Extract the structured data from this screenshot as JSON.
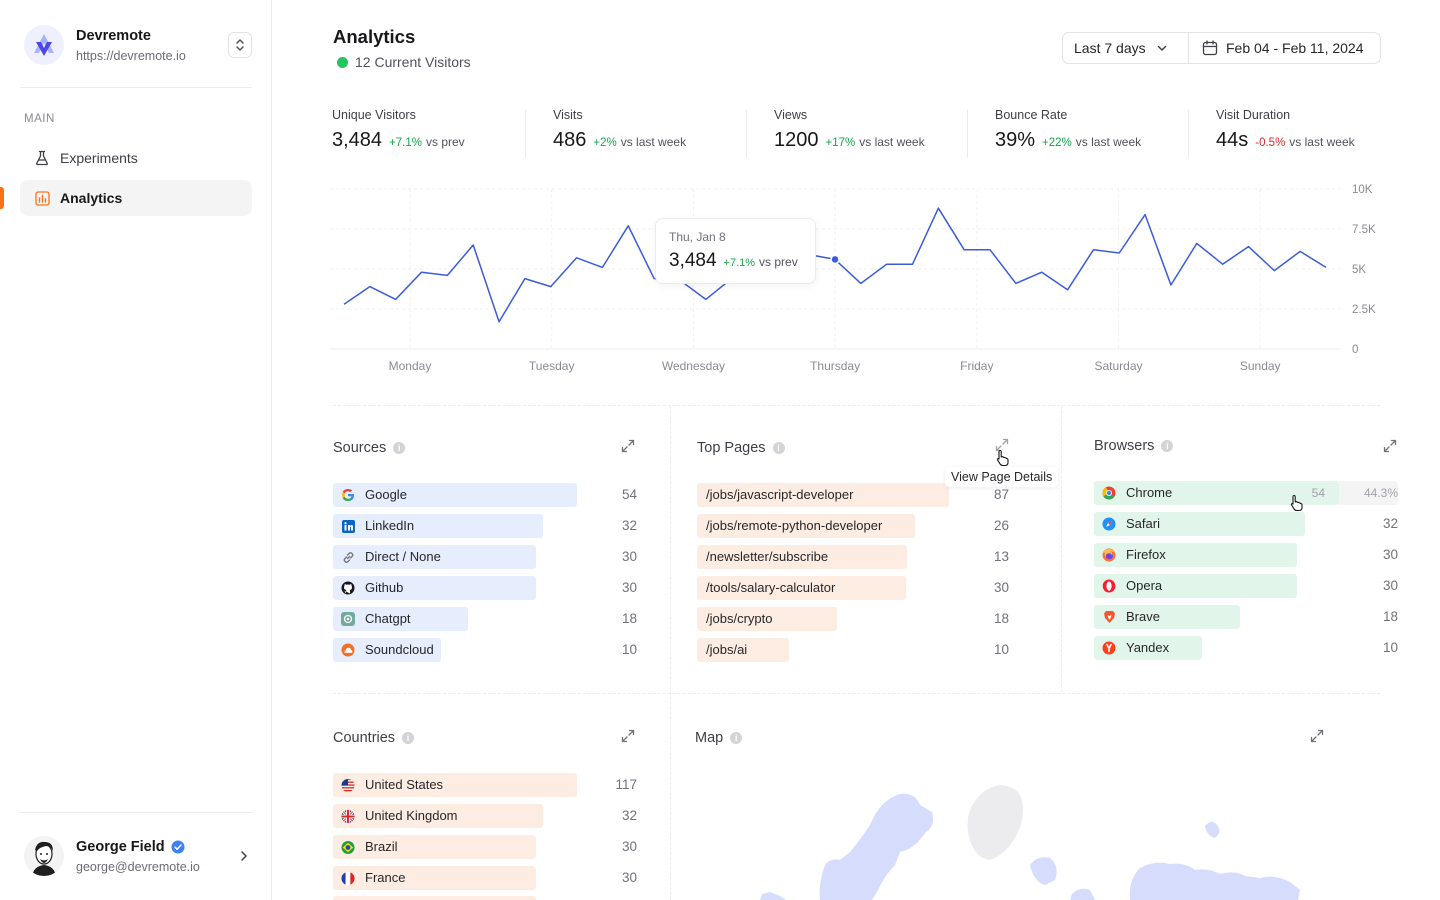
{
  "sidebar": {
    "org": {
      "name": "Devremote",
      "url": "https://devremote.io"
    },
    "section": "MAIN",
    "items": [
      {
        "label": "Experiments",
        "icon": "flask-icon"
      },
      {
        "label": "Analytics",
        "icon": "bar-chart-icon",
        "active": true
      }
    ],
    "user": {
      "name": "George Field",
      "email": "george@devremote.io",
      "verified": true
    }
  },
  "header": {
    "title": "Analytics",
    "current_visitors": "12 Current Visitors",
    "range_select": "Last 7 days",
    "date_range": "Feb 04 - Feb 11, 2024"
  },
  "stats": [
    {
      "label": "Unique Visitors",
      "value": "3,484",
      "delta": "+7.1%",
      "compare": "vs prev",
      "trend": "up"
    },
    {
      "label": "Visits",
      "value": "486",
      "delta": "+2%",
      "compare": "vs last week",
      "trend": "up"
    },
    {
      "label": "Views",
      "value": "1200",
      "delta": "+17%",
      "compare": "vs last week",
      "trend": "up"
    },
    {
      "label": "Bounce Rate",
      "value": "39%",
      "delta": "+22%",
      "compare": "vs last week",
      "trend": "up"
    },
    {
      "label": "Visit Duration",
      "value": "44s",
      "delta": "-0.5%",
      "compare": "vs last week",
      "trend": "down"
    }
  ],
  "chart_data": {
    "type": "line",
    "categories": [
      "Monday",
      "Tuesday",
      "Wednesday",
      "Thursday",
      "Friday",
      "Saturday",
      "Sunday"
    ],
    "yticks": [
      "10K",
      "7.5K",
      "5K",
      "2.5K",
      "0"
    ],
    "ylim": [
      0,
      10000
    ],
    "series": [
      {
        "values": [
          2800,
          3900,
          3100,
          4800,
          4600,
          6500,
          1700,
          4400,
          3900,
          5700,
          5100,
          7700,
          4400,
          4300,
          3100,
          4400,
          5400,
          6100,
          5900,
          5600,
          4100,
          5300,
          5300,
          8800,
          6200,
          6200,
          4100,
          4800,
          3700,
          6200,
          6000,
          8400,
          4000,
          6600,
          5300,
          6400,
          4900,
          6100,
          5100
        ],
        "color": "#3b5bdb"
      }
    ],
    "highlight_index": 19,
    "tooltip": {
      "date": "Thu, Jan 8",
      "value": "3,484",
      "delta": "+7.1%",
      "compare": "vs prev"
    }
  },
  "sources": {
    "title": "Sources",
    "rows": [
      {
        "label": "Google",
        "value": "54",
        "icon": "google-icon"
      },
      {
        "label": "LinkedIn",
        "value": "32",
        "icon": "linkedin-icon"
      },
      {
        "label": "Direct / None",
        "value": "30",
        "icon": "link-icon"
      },
      {
        "label": "Github",
        "value": "30",
        "icon": "github-icon"
      },
      {
        "label": "Chatgpt",
        "value": "18",
        "icon": "chatgpt-icon"
      },
      {
        "label": "Soundcloud",
        "value": "10",
        "icon": "soundcloud-icon"
      }
    ]
  },
  "top_pages": {
    "title": "Top Pages",
    "hint": "View Page Details",
    "rows": [
      {
        "label": "/jobs/javascript-developer",
        "value": "87"
      },
      {
        "label": "/jobs/remote-python-developer",
        "value": "26"
      },
      {
        "label": "/newsletter/subscribe",
        "value": "13"
      },
      {
        "label": "/tools/salary-calculator",
        "value": "30"
      },
      {
        "label": "/jobs/crypto",
        "value": "18"
      },
      {
        "label": "/jobs/ai",
        "value": "10"
      }
    ]
  },
  "browsers": {
    "title": "Browsers",
    "rows": [
      {
        "label": "Chrome",
        "value": "54",
        "pct": "44.3%",
        "icon": "chrome-icon"
      },
      {
        "label": "Safari",
        "value": "32",
        "icon": "safari-icon"
      },
      {
        "label": "Firefox",
        "value": "30",
        "icon": "firefox-icon"
      },
      {
        "label": "Opera",
        "value": "30",
        "icon": "opera-icon"
      },
      {
        "label": "Brave",
        "value": "18",
        "icon": "brave-icon"
      },
      {
        "label": "Yandex",
        "value": "10",
        "icon": "yandex-icon"
      }
    ]
  },
  "countries": {
    "title": "Countries",
    "rows": [
      {
        "label": "United States",
        "value": "117",
        "icon": "us-flag-icon"
      },
      {
        "label": "United Kingdom",
        "value": "32",
        "icon": "uk-flag-icon"
      },
      {
        "label": "Brazil",
        "value": "30",
        "icon": "brazil-flag-icon"
      },
      {
        "label": "France",
        "value": "30",
        "icon": "france-flag-icon"
      }
    ]
  },
  "map": {
    "title": "Map"
  }
}
